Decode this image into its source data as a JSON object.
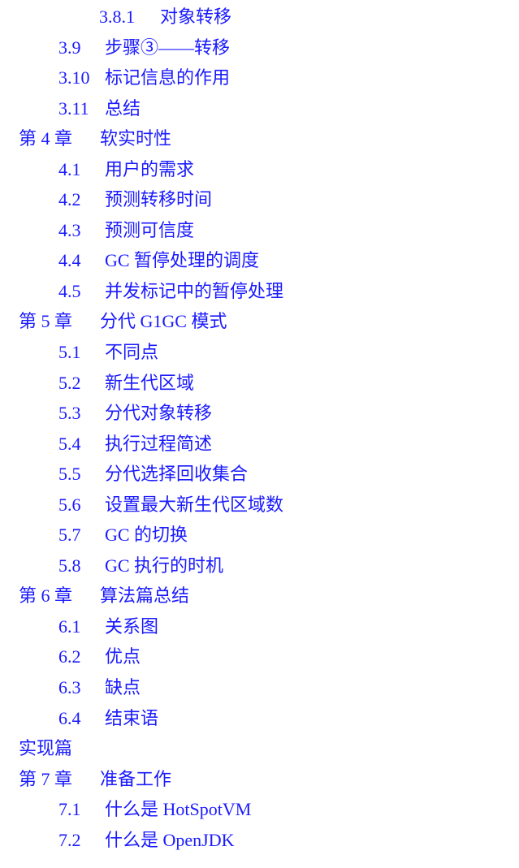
{
  "toc": {
    "items": [
      {
        "level": 2,
        "number": "3.8.1",
        "title": "对象转移"
      },
      {
        "level": 1,
        "number": "3.9",
        "title": "步骤③——转移"
      },
      {
        "level": 1,
        "number": "3.10",
        "title": "标记信息的作用"
      },
      {
        "level": 1,
        "number": "3.11",
        "title": "总结"
      },
      {
        "level": 0,
        "number": "第 4 章",
        "title": "软实时性"
      },
      {
        "level": 1,
        "number": "4.1",
        "title": "用户的需求"
      },
      {
        "level": 1,
        "number": "4.2",
        "title": "预测转移时间"
      },
      {
        "level": 1,
        "number": "4.3",
        "title": "预测可信度"
      },
      {
        "level": 1,
        "number": "4.4",
        "title": "GC 暂停处理的调度"
      },
      {
        "level": 1,
        "number": "4.5",
        "title": "并发标记中的暂停处理"
      },
      {
        "level": 0,
        "number": "第 5 章",
        "title": "分代 G1GC 模式"
      },
      {
        "level": 1,
        "number": "5.1",
        "title": "不同点"
      },
      {
        "level": 1,
        "number": "5.2",
        "title": "新生代区域"
      },
      {
        "level": 1,
        "number": "5.3",
        "title": "分代对象转移"
      },
      {
        "level": 1,
        "number": "5.4",
        "title": "执行过程简述"
      },
      {
        "level": 1,
        "number": "5.5",
        "title": "分代选择回收集合"
      },
      {
        "level": 1,
        "number": "5.6",
        "title": "设置最大新生代区域数"
      },
      {
        "level": 1,
        "number": "5.7",
        "title": "GC 的切换"
      },
      {
        "level": 1,
        "number": "5.8",
        "title": "GC 执行的时机"
      },
      {
        "level": 0,
        "number": "第 6 章",
        "title": "算法篇总结"
      },
      {
        "level": 1,
        "number": "6.1",
        "title": "关系图"
      },
      {
        "level": 1,
        "number": "6.2",
        "title": "优点"
      },
      {
        "level": 1,
        "number": "6.3",
        "title": "缺点"
      },
      {
        "level": 1,
        "number": "6.4",
        "title": "结束语"
      },
      {
        "level": 0,
        "number": "",
        "title": "实现篇",
        "part": true
      },
      {
        "level": 0,
        "number": "第 7 章",
        "title": "准备工作"
      },
      {
        "level": 1,
        "number": "7.1",
        "title": "什么是 HotSpotVM"
      },
      {
        "level": 1,
        "number": "7.2",
        "title": "什么是 OpenJDK"
      }
    ]
  },
  "colors": {
    "link": "#1a1aff",
    "background": "#ffffff"
  }
}
